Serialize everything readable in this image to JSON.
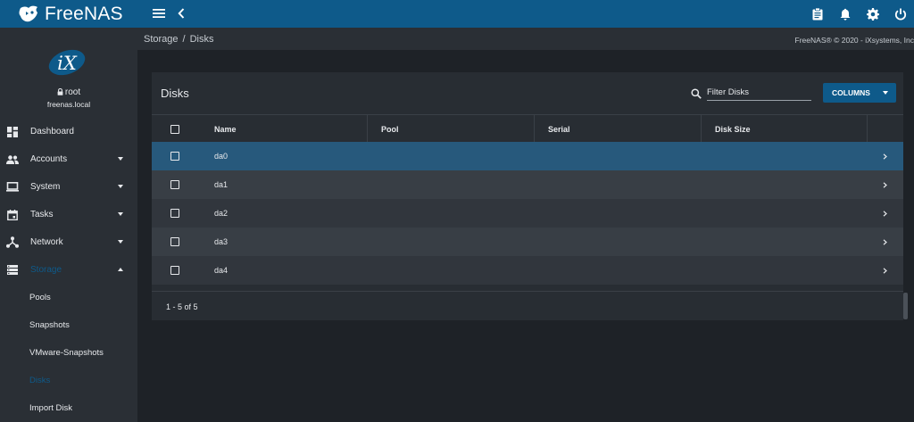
{
  "topbar": {
    "brand": "FreeNAS",
    "icons": [
      "menu-icon",
      "chevron-left-icon",
      "clipboard-icon",
      "bell-icon",
      "gear-icon",
      "power-icon"
    ]
  },
  "user": {
    "name": "root",
    "host": "freenas.local",
    "logo_text": "iX"
  },
  "sidebar": {
    "items": [
      {
        "label": "Dashboard",
        "icon": "dashboard-icon"
      },
      {
        "label": "Accounts",
        "icon": "people-icon"
      },
      {
        "label": "System",
        "icon": "laptop-icon"
      },
      {
        "label": "Tasks",
        "icon": "calendar-icon"
      },
      {
        "label": "Network",
        "icon": "network-icon"
      },
      {
        "label": "Storage",
        "icon": "storage-icon"
      }
    ],
    "storage_sub": [
      "Pools",
      "Snapshots",
      "VMware-Snapshots",
      "Disks",
      "Import Disk"
    ]
  },
  "breadcrumb": {
    "root": "Storage",
    "separator": "/",
    "current": "Disks"
  },
  "copyright": "FreeNAS® © 2020 - iXsystems, Inc",
  "disks": {
    "title": "Disks",
    "filter_placeholder": "Filter Disks",
    "columns_label": "COLUMNS",
    "headers": [
      "Name",
      "Pool",
      "Serial",
      "Disk Size"
    ],
    "rows": [
      {
        "name": "da0"
      },
      {
        "name": "da1"
      },
      {
        "name": "da2"
      },
      {
        "name": "da3"
      },
      {
        "name": "da4"
      }
    ],
    "pager": "1 - 5 of 5"
  },
  "colors": {
    "topbar": "#0e5a8a",
    "accent": "#0e5a8a",
    "selected_row": "#27597c",
    "sidebar": "#2a2f35",
    "background": "#1e2227"
  }
}
